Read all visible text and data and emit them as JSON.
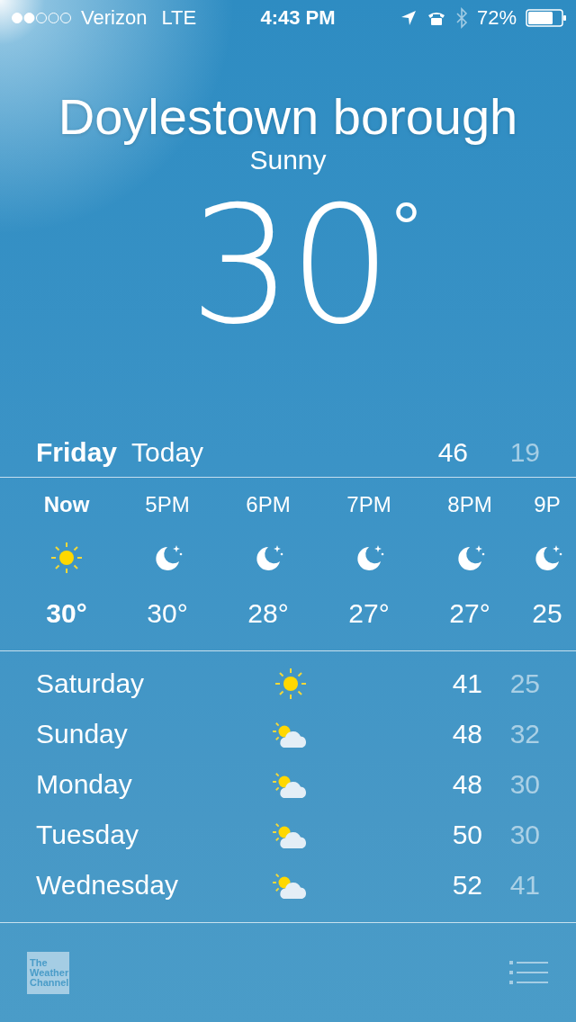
{
  "status_bar": {
    "carrier": "Verizon",
    "network": "LTE",
    "time": "4:43 PM",
    "battery": "72%"
  },
  "location": {
    "city": "Doylestown borough",
    "condition": "Sunny",
    "temperature": "30",
    "degree": "°"
  },
  "today": {
    "day": "Friday",
    "label": "Today",
    "high": "46",
    "low": "19"
  },
  "hourly": [
    {
      "time": "Now",
      "kind": "sun",
      "temp": "30°",
      "now": true
    },
    {
      "time": "5PM",
      "kind": "moon",
      "temp": "30°",
      "now": false
    },
    {
      "time": "6PM",
      "kind": "moon",
      "temp": "28°",
      "now": false
    },
    {
      "time": "7PM",
      "kind": "moon",
      "temp": "27°",
      "now": false
    },
    {
      "time": "8PM",
      "kind": "moon",
      "temp": "27°",
      "now": false
    },
    {
      "time": "9P",
      "kind": "moon",
      "temp": "25",
      "now": false
    }
  ],
  "daily": [
    {
      "day": "Saturday",
      "kind": "sun",
      "high": "41",
      "low": "25"
    },
    {
      "day": "Sunday",
      "kind": "partly-cloudy",
      "high": "48",
      "low": "32"
    },
    {
      "day": "Monday",
      "kind": "partly-cloudy",
      "high": "48",
      "low": "30"
    },
    {
      "day": "Tuesday",
      "kind": "partly-cloudy",
      "high": "50",
      "low": "30"
    },
    {
      "day": "Wednesday",
      "kind": "partly-cloudy",
      "high": "52",
      "low": "41"
    }
  ],
  "footer": {
    "logo": [
      "The",
      "Weather",
      "Channel"
    ]
  }
}
